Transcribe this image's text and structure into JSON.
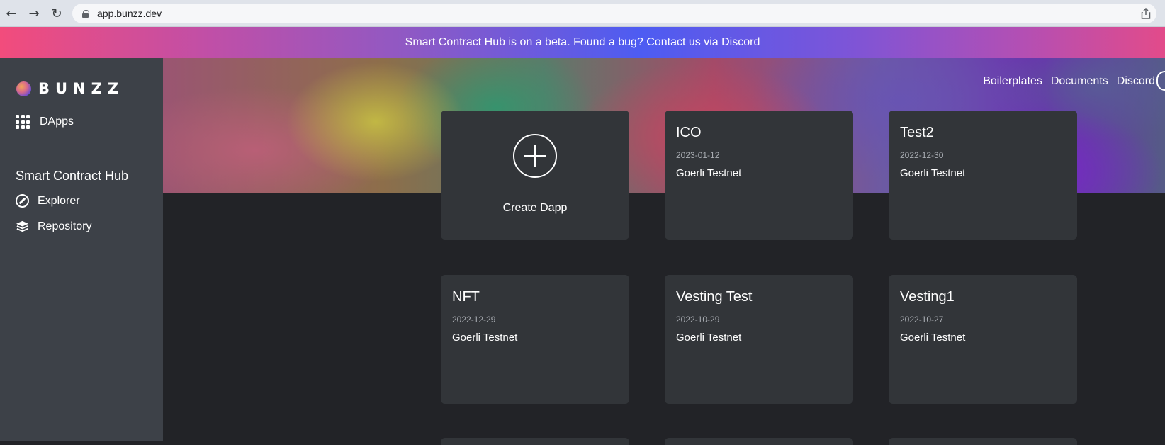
{
  "browser": {
    "url": "app.bunzz.dev"
  },
  "banner": {
    "text": "Smart Contract Hub is on a beta. Found a bug? Contact us via Discord"
  },
  "sidebar": {
    "logo_text": "BUNZZ",
    "items": [
      {
        "label": "DApps",
        "icon": "grid-icon"
      }
    ],
    "section_title": "Smart Contract Hub",
    "section_items": [
      {
        "label": "Explorer",
        "icon": "compass-icon"
      },
      {
        "label": "Repository",
        "icon": "layers-icon"
      }
    ]
  },
  "topnav": {
    "links": [
      "Boilerplates",
      "Documents",
      "Discord"
    ]
  },
  "create_card": {
    "label": "Create Dapp"
  },
  "dapps": [
    {
      "name": "ICO",
      "date": "2023-01-12",
      "network": "Goerli Testnet"
    },
    {
      "name": "Test2",
      "date": "2022-12-30",
      "network": "Goerli Testnet"
    },
    {
      "name": "NFT",
      "date": "2022-12-29",
      "network": "Goerli Testnet"
    },
    {
      "name": "Vesting Test",
      "date": "2022-10-29",
      "network": "Goerli Testnet"
    },
    {
      "name": "Vesting1",
      "date": "2022-10-27",
      "network": "Goerli Testnet"
    }
  ]
}
